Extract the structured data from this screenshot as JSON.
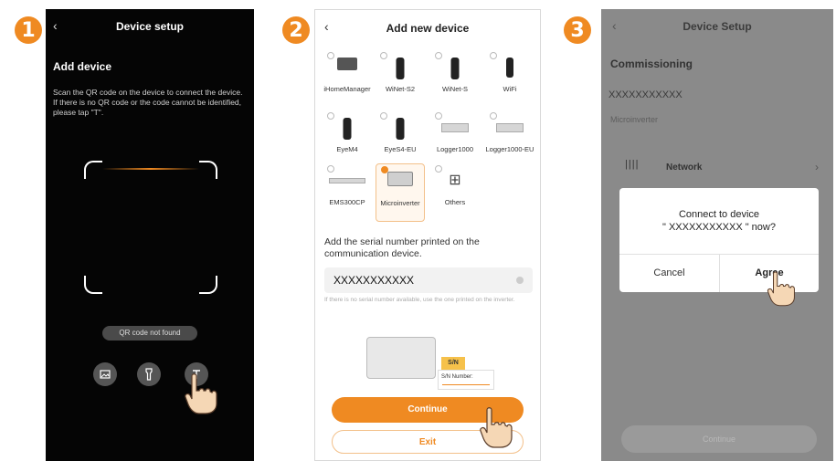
{
  "steps": [
    "1",
    "2",
    "3"
  ],
  "screen1": {
    "title": "Device setup",
    "heading": "Add device",
    "description": "Scan the QR code on the device to connect the device. If there is no QR code or the code cannot be identified, please tap \"T\".",
    "not_found": "QR code not found",
    "buttons": [
      "image-icon",
      "flashlight-icon",
      "text-input-icon"
    ]
  },
  "screen2": {
    "title": "Add new device",
    "devices": [
      {
        "label": "iHomeManager",
        "icon": "home-manager-icon",
        "selected": false
      },
      {
        "label": "WiNet-S2",
        "icon": "winet-icon",
        "selected": false
      },
      {
        "label": "WiNet-S",
        "icon": "winet-icon",
        "selected": false
      },
      {
        "label": "WiFi",
        "icon": "wifi-dongle-icon",
        "selected": false
      },
      {
        "label": "EyeM4",
        "icon": "eye-icon",
        "selected": false
      },
      {
        "label": "EyeS4-EU",
        "icon": "eye-icon",
        "selected": false
      },
      {
        "label": "Logger1000",
        "icon": "logger-icon",
        "selected": false
      },
      {
        "label": "Logger1000-EU",
        "icon": "logger-icon",
        "selected": false
      },
      {
        "label": "EMS300CP",
        "icon": "ems-icon",
        "selected": false
      },
      {
        "label": "Microinverter",
        "icon": "microinverter-icon",
        "selected": true
      },
      {
        "label": "Others",
        "icon": "grid-icon",
        "selected": false
      }
    ],
    "add_text": "Add the serial number printed on the communication device.",
    "serial_value": "XXXXXXXXXXX",
    "hint": "If there is no serial number available, use the one printed on the inverter.",
    "sn_tag": "S/N",
    "sn_card": "S/N Number:",
    "continue_label": "Continue",
    "exit_label": "Exit"
  },
  "screen3": {
    "title": "Device Setup",
    "section": "Commissioning",
    "serial": "XXXXXXXXXXX",
    "device_type": "Microinverter",
    "network_label": "Network",
    "dialog": {
      "line1": "Connect to device",
      "line2": "\" XXXXXXXXXXX \" now?",
      "cancel": "Cancel",
      "agree": "Agree"
    },
    "continue_label": "Continue"
  },
  "colors": {
    "accent": "#ef8a22",
    "dark_bg": "#050505",
    "overlay": "#8a8a8a"
  }
}
